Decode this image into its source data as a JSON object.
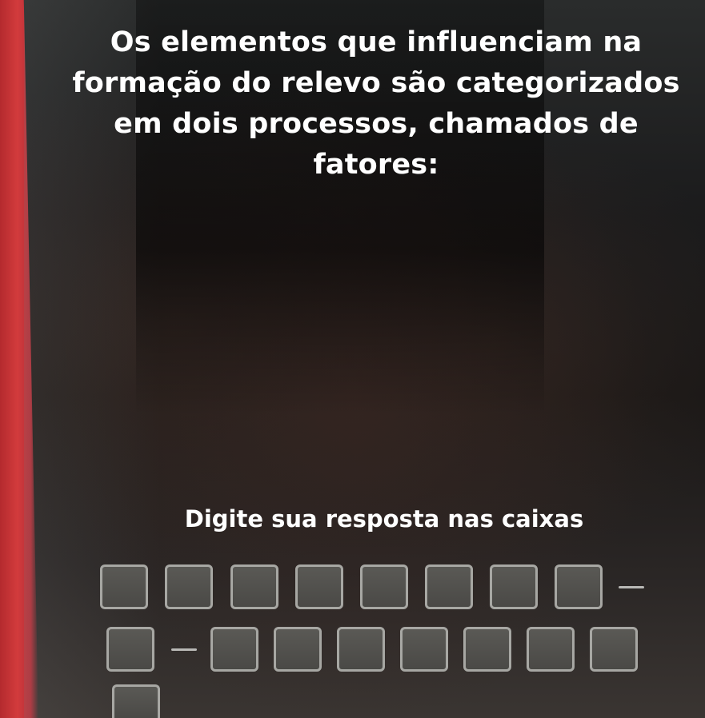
{
  "question": {
    "lines": [
      "Os elementos que influenciam na",
      "formação do relevo são categorizados",
      "em dois processos, chamados de",
      "fatores:"
    ]
  },
  "instruction": "Digite sua resposta nas caixas",
  "answer": {
    "row1_boxes": 8,
    "row1_separator": "-",
    "row2_lead_boxes": 1,
    "row2_separator": "-",
    "row2_boxes": 7,
    "row3_boxes": 1
  },
  "colors": {
    "text": "#ffffff",
    "box_border": "#a7a7a3",
    "box_fill": "#52514e",
    "edge_red": "#d23b3c"
  }
}
